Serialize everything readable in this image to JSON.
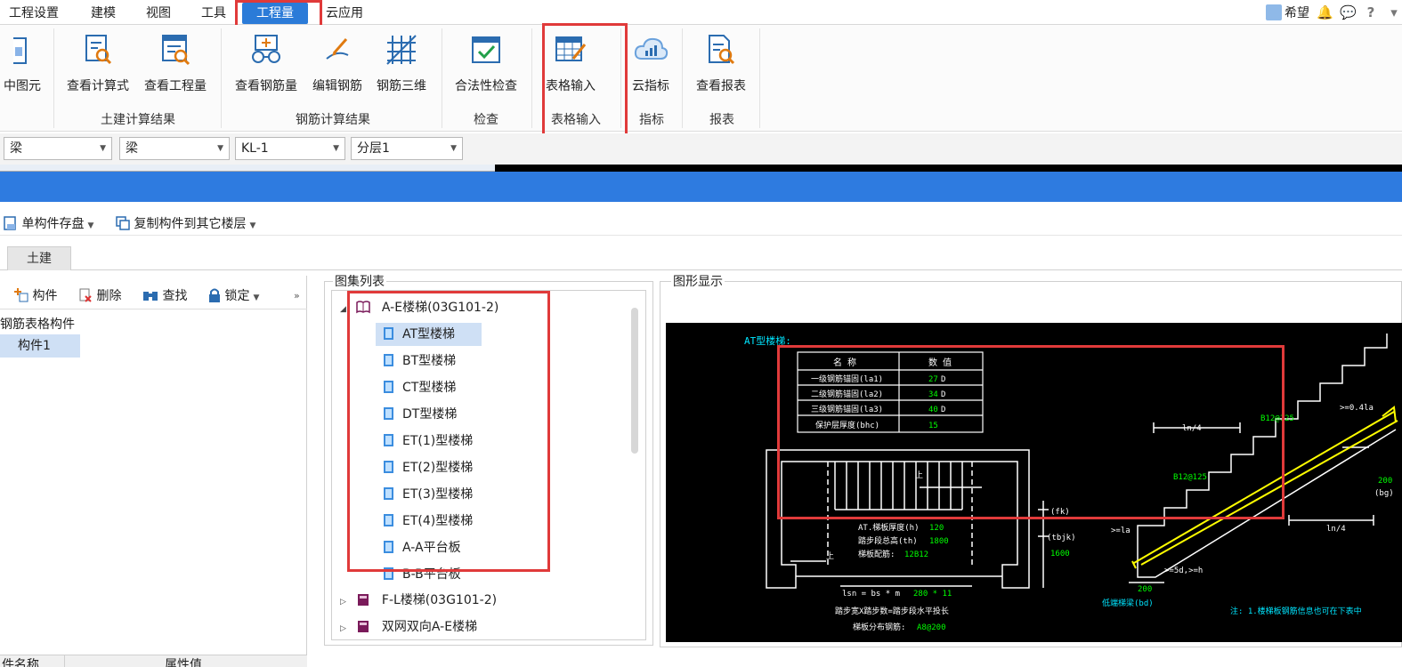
{
  "menu": {
    "items": [
      "工程设置",
      "建模",
      "视图",
      "工具",
      "工程量",
      "云应用"
    ],
    "active_index": 4,
    "user_name": "希望",
    "icons": [
      "bell-icon",
      "chat-icon",
      "help-icon",
      "shirt-icon"
    ]
  },
  "ribbon": {
    "buttons": [
      {
        "label": "中图元",
        "icon": "select-element-icon"
      },
      {
        "label": "查看计算式",
        "icon": "view-formula-icon"
      },
      {
        "label": "查看工程量",
        "icon": "view-quantity-icon"
      },
      {
        "label": "查看钢筋量",
        "icon": "view-rebar-icon"
      },
      {
        "label": "编辑钢筋",
        "icon": "edit-rebar-icon"
      },
      {
        "label": "钢筋三维",
        "icon": "rebar-3d-icon"
      },
      {
        "label": "合法性检查",
        "icon": "validity-check-icon"
      },
      {
        "label": "表格输入",
        "icon": "table-input-icon"
      },
      {
        "label": "云指标",
        "icon": "cloud-index-icon"
      },
      {
        "label": "查看报表",
        "icon": "view-report-icon"
      }
    ],
    "groups": [
      "土建计算结果",
      "钢筋计算结果",
      "检查",
      "表格输入",
      "指标",
      "报表"
    ]
  },
  "selectors": [
    "梁",
    "梁",
    "KL-1",
    "分层1"
  ],
  "toolbar": {
    "save_label": "单构件存盘",
    "copy_label": "复制构件到其它楼层"
  },
  "tabs": {
    "tujian": "土建"
  },
  "left_panel": {
    "tools": [
      "构件",
      "删除",
      "查找",
      "锁定"
    ],
    "root": "钢筋表格构件",
    "item": "构件1",
    "columns": [
      "件名称",
      "属性值"
    ]
  },
  "atlas": {
    "title": "图集列表",
    "groups": [
      {
        "label": "A-E楼梯(03G101-2)",
        "expanded": true
      },
      {
        "label": "F-L楼梯(03G101-2)",
        "expanded": false
      },
      {
        "label": "双网双向A-E楼梯",
        "expanded": false
      }
    ],
    "items": [
      "AT型楼梯",
      "BT型楼梯",
      "CT型楼梯",
      "DT型楼梯",
      "ET(1)型楼梯",
      "ET(2)型楼梯",
      "ET(3)型楼梯",
      "ET(4)型楼梯",
      "A-A平台板",
      "B-B平台板"
    ],
    "selected_index": 0
  },
  "display": {
    "title": "图形显示",
    "drawing_title": "AT型楼梯:",
    "table_header": [
      "名  称",
      "数  值"
    ],
    "table_rows": [
      {
        "name": "一级钢筋锚固(la1)",
        "value": "27",
        "unit": "D"
      },
      {
        "name": "二级钢筋锚固(la2)",
        "value": "34",
        "unit": "D"
      },
      {
        "name": "三级钢筋锚固(la3)",
        "value": "40",
        "unit": "D"
      },
      {
        "name": "保护层厚度(bhc)",
        "value": "15",
        "unit": ""
      }
    ],
    "plan_labels": {
      "thickness_label": "AT.梯板厚度(h)",
      "thickness_value": "120",
      "height_label": "踏步段总高(th)",
      "height_value": "1800",
      "rebar_label": "梯板配筋:",
      "rebar_value": "12B12",
      "up_label": "上",
      "fk": "(fk)",
      "tbjk": "(tbjk)",
      "tbjk_value": "1600",
      "lsn": "lsn = bs * m",
      "lsn_value": "280 * 11",
      "step_note": "踏步宽X踏步数=踏步段水平投长",
      "dist_label": "梯板分布钢筋:",
      "dist_value": "A8@200"
    },
    "section_labels": {
      "ln4_a": "ln/4",
      "ln4_b": "ln/4",
      "rebar_a": "B12@125",
      "rebar_b": "B12@125",
      "top_note": ">=0.4la",
      "la": ">=la",
      "five_d": ">=5d,>=h",
      "v200_a": "200",
      "v200_b": "200",
      "bg": "(bg)",
      "bd": "低端梯梁(bd)"
    },
    "footnote": "注: 1.楼梯板钢筋信息也可在下表中"
  },
  "colors": {
    "accent_blue": "#2e7be0",
    "highlight_red": "#e03a3a",
    "cad_green": "#00ff00",
    "cad_cyan": "#00e5ff",
    "cad_yellow": "#ffff00"
  }
}
